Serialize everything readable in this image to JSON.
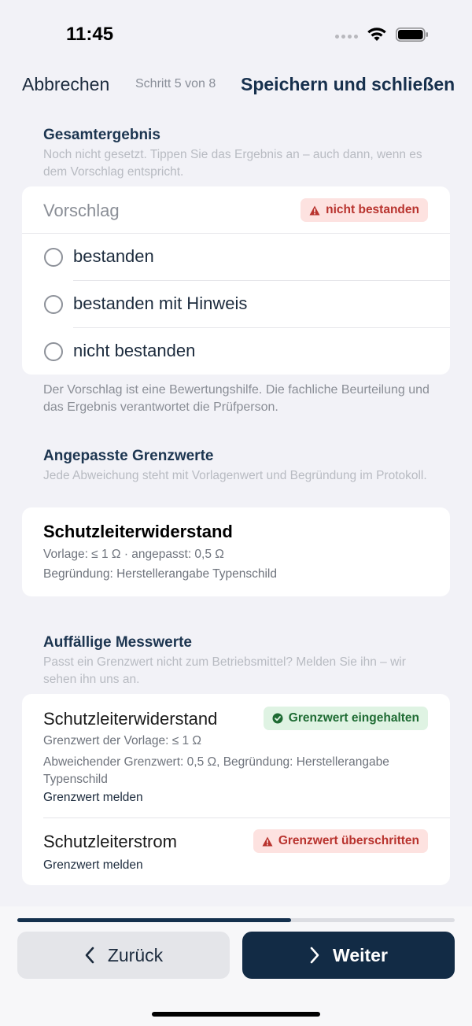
{
  "status": {
    "time": "11:45"
  },
  "nav": {
    "cancel": "Abbrechen",
    "step": "Schritt 5 von 8",
    "save": "Speichern und schließen"
  },
  "result": {
    "title": "Gesamtergebnis",
    "description": "Noch nicht gesetzt. Tippen Sie das Ergebnis an – auch dann, wenn es dem Vorschlag entspricht.",
    "proposal_label": "Vorschlag",
    "proposal_badge": "nicht bestanden",
    "options": [
      "bestanden",
      "bestanden mit Hinweis",
      "nicht bestanden"
    ],
    "footnote": "Der Vorschlag ist eine Bewertungshilfe. Die fachliche Beurteilung und das Ergebnis verantwortet die Prüfperson."
  },
  "limits": {
    "title": "Angepasste Grenzwerte",
    "description": "Jede Abweichung steht mit Vorlagenwert und Begründung im Protokoll.",
    "card": {
      "name": "Schutzleiterwiderstand",
      "values": "Vorlage: ≤ 1 Ω · angepasst: 0,5 Ω",
      "reason": "Begründung: Herstellerangabe Typenschild"
    }
  },
  "measurements": {
    "title": "Auffällige Messwerte",
    "description": "Passt ein Grenzwert nicht zum Betriebsmittel? Melden Sie ihn – wir sehen ihn uns an.",
    "items": [
      {
        "name": "Schutzleiterwiderstand",
        "badge": "Grenzwert eingehalten",
        "template_limit": "Grenzwert der Vorlage: ≤ 1 Ω",
        "deviation": "Abweichender Grenzwert: 0,5 Ω, Begründung: Herstellerangabe Typenschild",
        "report": "Grenzwert melden"
      },
      {
        "name": "Schutzleiterstrom",
        "badge": "Grenzwert überschritten",
        "report": "Grenzwert melden"
      }
    ]
  },
  "footer": {
    "progress": 0.625,
    "back": "Zurück",
    "next": "Weiter"
  },
  "colors": {
    "primary": "#122b45",
    "badge_red_bg": "#fde2e0",
    "badge_red_text": "#b8332e",
    "badge_green_bg": "#dff3e3",
    "badge_green_text": "#1e6b33"
  }
}
